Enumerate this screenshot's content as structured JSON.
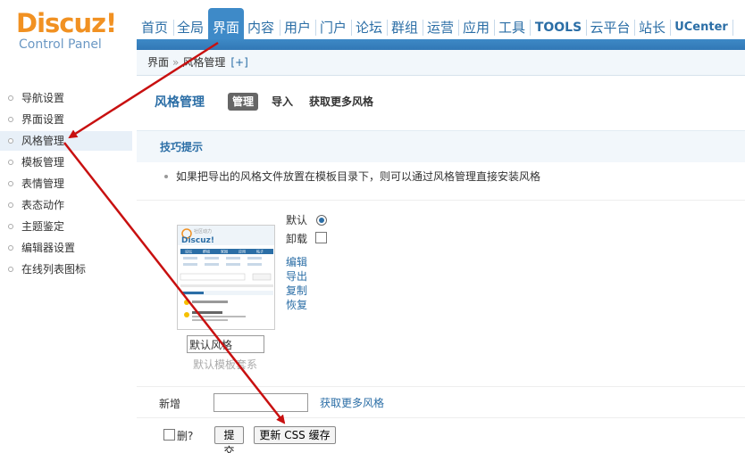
{
  "header": {
    "logo_text": "Discuz",
    "logo_bang": "!",
    "logo_sub": "Control Panel",
    "nav": [
      "首页",
      "全局",
      "界面",
      "内容",
      "用户",
      "门户",
      "论坛",
      "群组",
      "运营",
      "应用",
      "工具",
      "TOOLS",
      "云平台",
      "站长",
      "UCenter"
    ],
    "active_index": 2
  },
  "breadcrumb": {
    "part1": "界面",
    "sep": "»",
    "part2": "风格管理",
    "plus": "[+]"
  },
  "sidebar": {
    "items": [
      {
        "label": "导航设置"
      },
      {
        "label": "界面设置"
      },
      {
        "label": "风格管理"
      },
      {
        "label": "模板管理"
      },
      {
        "label": "表情管理"
      },
      {
        "label": "表态动作"
      },
      {
        "label": "主题鉴定"
      },
      {
        "label": "编辑器设置"
      },
      {
        "label": "在线列表图标"
      }
    ],
    "active_index": 2
  },
  "main": {
    "title": "风格管理",
    "tabs": [
      "管理",
      "导入",
      "获取更多风格"
    ],
    "tips_title": "技巧提示",
    "tips_text": "如果把导出的风格文件放置在模板目录下，则可以通过风格管理直接安装风格",
    "style": {
      "name_value": "默认风格",
      "system_name": "默认模板套系",
      "default_label": "默认",
      "uninstall_label": "卸载",
      "actions": [
        "编辑",
        "导出",
        "复制",
        "恢复"
      ]
    },
    "add_label": "新增",
    "add_link": "获取更多风格",
    "delete_label": "删?",
    "submit_label": "提交",
    "refresh_css_label": "更新 CSS 缓存"
  },
  "thumbnail": {
    "brand": "Discuz!",
    "tagline": "社区动力",
    "nav": [
      "论坛",
      "群组",
      "家园",
      "应用",
      "帖子"
    ]
  },
  "colors": {
    "accent": "#2b6ea6",
    "nav_active": "#3e8ac8",
    "logo": "#f19122",
    "arrow": "#c81010"
  }
}
